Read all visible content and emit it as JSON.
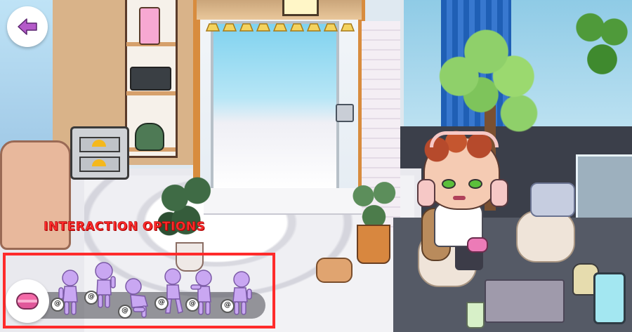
{
  "scene": {
    "label": "INTERACTION OPTIONS",
    "label_color": "#ff2a2a",
    "highlight_color": "#ff2b2b",
    "accent_purple": "#c9a7f2"
  },
  "toolbar": {
    "back_icon": "left-arrow-icon",
    "item_icon": "macaron-icon"
  },
  "poses": [
    {
      "name": "stand-hold",
      "tag": "@"
    },
    {
      "name": "stand-wave",
      "tag": "@"
    },
    {
      "name": "sit-crouch",
      "tag": "@"
    },
    {
      "name": "walk",
      "tag": "@"
    },
    {
      "name": "reach",
      "tag": "@"
    },
    {
      "name": "lean",
      "tag": "@"
    }
  ]
}
